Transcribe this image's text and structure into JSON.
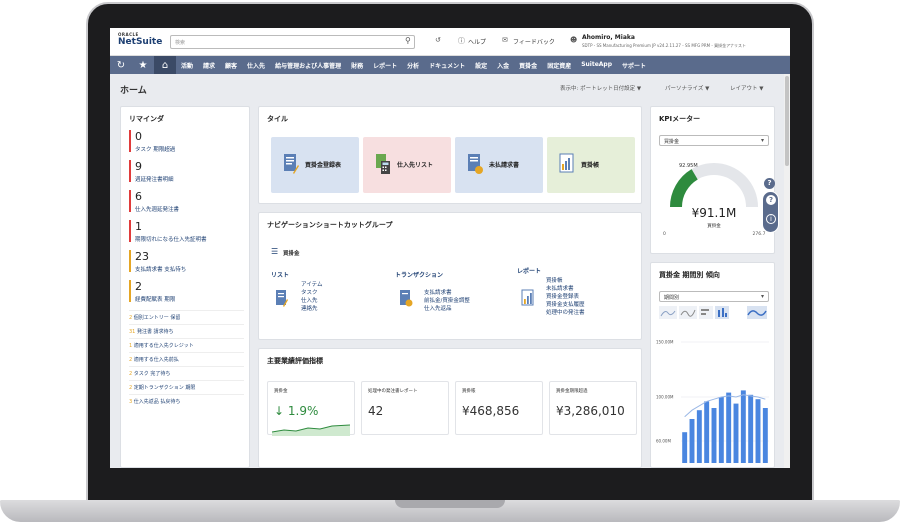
{
  "header": {
    "logo_oracle": "ORACLE",
    "logo_netsuite": "NetSuite",
    "search_placeholder": "検索",
    "help": "ヘルプ",
    "feedback": "フィードバック",
    "user_name": "Ahomiro, Miaka",
    "user_role": "SDTP - SS Manufacturing Premium JP v24.2.11.27 - SS MFG PRM - 買掛金アナリスト"
  },
  "nav": {
    "items": [
      "活動",
      "請求",
      "顧客",
      "仕入先",
      "給与管理および人事管理",
      "財務",
      "レポート",
      "分析",
      "ドキュメント",
      "設定",
      "入金",
      "買掛金",
      "固定資産",
      "SuiteApp",
      "サポート"
    ]
  },
  "page": {
    "title": "ホーム",
    "display_setting": "表示中: ポートレット日付設定 ▼",
    "personalize": "パーソナライズ ▼",
    "layout": "レイアウト ▼"
  },
  "reminders": {
    "title": "リマインダ",
    "items": [
      {
        "count": "0",
        "label": "タスク 期限超過",
        "color": "#e03b3b"
      },
      {
        "count": "9",
        "label": "週延発注書明細",
        "color": "#e03b3b"
      },
      {
        "count": "6",
        "label": "仕入先週延発注書",
        "color": "#e03b3b"
      },
      {
        "count": "1",
        "label": "期限切れになる仕入先証明書",
        "color": "#e03b3b"
      },
      {
        "count": "23",
        "label": "支払請求書 支払待ち",
        "color": "#e5a625"
      },
      {
        "count": "2",
        "label": "経費配賦表 期限",
        "color": "#e5a625"
      }
    ],
    "small": [
      {
        "count": "2",
        "label": "個別エントリー 保留"
      },
      {
        "count": "31",
        "label": "発注書 請求待ち"
      },
      {
        "count": "1",
        "label": "適用する仕入先クレジット"
      },
      {
        "count": "2",
        "label": "適用する仕入先前払"
      },
      {
        "count": "2",
        "label": "タスク 完了待ち"
      },
      {
        "count": "2",
        "label": "定期トランザクション 期限"
      },
      {
        "count": "3",
        "label": "仕入先返品 払戻待ち"
      }
    ]
  },
  "tiles": {
    "title": "タイル",
    "items": [
      {
        "label": "買掛金登録表",
        "bg": "#d8e2f1"
      },
      {
        "label": "仕入先リスト",
        "bg": "#f7dfe0"
      },
      {
        "label": "未払請求書",
        "bg": "#d8e2f1"
      },
      {
        "label": "買掛帳",
        "bg": "#e6efd9"
      }
    ]
  },
  "shortcuts": {
    "title": "ナビゲーションショートカットグループ",
    "group": "買掛金",
    "list_title": "リスト",
    "list_items": [
      "アイテム",
      "タスク",
      "仕入先",
      "連絡先"
    ],
    "tx_title": "トランザクション",
    "tx_items": [
      "支払請求書",
      "前払金/買掛金調整",
      "仕入先返品"
    ],
    "report_title": "レポート",
    "report_items": [
      "買掛帳",
      "未払請求書",
      "買掛金登録表",
      "買掛金支払履歴",
      "処理中の発注書"
    ]
  },
  "kpi_scorecard": {
    "title": "主要業績評価指標",
    "cards": [
      {
        "label": "買掛金",
        "value": "↓ 1.9%"
      },
      {
        "label": "処理中の発注書レポート",
        "value": "42"
      },
      {
        "label": "買掛帳",
        "value": "¥468,856"
      },
      {
        "label": "買掛金期限超過",
        "value": "¥3,286,010"
      }
    ]
  },
  "kpi_meter": {
    "title": "KPIメーター",
    "select": "買掛金",
    "value": "¥91.1M",
    "value_label": "買掛金",
    "marker": "92.95M",
    "min": "0",
    "max": "276.7",
    "fraction": 0.33,
    "colors": {
      "fill": "#2e8b3e",
      "track": "#e4e6ea"
    }
  },
  "trend": {
    "title": "買掛金 期間別 傾向",
    "select": "期間別",
    "y_ticks": [
      "150.00M",
      "100.00M",
      "60.00M"
    ]
  },
  "chart_data": {
    "type": "bar",
    "title": "買掛金 期間別 傾向",
    "values": [
      68,
      80,
      88,
      96,
      90,
      100,
      104,
      94,
      106,
      102,
      98,
      90
    ],
    "line": [
      82,
      88,
      92,
      96,
      98,
      100,
      101,
      100,
      102,
      101,
      100,
      98
    ],
    "ylim": [
      40,
      160
    ]
  }
}
